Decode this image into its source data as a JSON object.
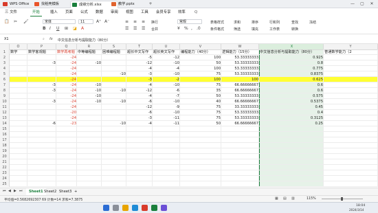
{
  "titlebar": {
    "tabs": [
      "WPS Office",
      "找稻壳模板",
      "成绩分析.xlsx",
      "教学.pptx"
    ],
    "minimize": "—",
    "maximize": "▢",
    "close": "✕"
  },
  "menu": {
    "items": [
      "三 文件",
      "开始",
      "插入",
      "页面",
      "公式",
      "数据",
      "审阅",
      "视图",
      "工具",
      "会员专享",
      "效率"
    ],
    "search": "Q"
  },
  "toolbar": {
    "font_name": "宋体",
    "font_size": "11",
    "wrap_label": "换行",
    "merge_label": "合并",
    "number_format": "常规",
    "table_style_label": "表格样式",
    "cond_format_label": "条件格式",
    "sum_label": "求和",
    "filter_label": "筛选",
    "sort_label": "排序",
    "fill_label": "填充",
    "rowcol_label": "行和列",
    "worksheet_label": "工作表",
    "find_label": "查找",
    "convert_label": "转换",
    "freeze_label": "冻结"
  },
  "formula": {
    "cell_ref": "X1",
    "fx": "fx",
    "content": "中文信息分析与提取能力（80分）"
  },
  "columns": [
    "O",
    "P",
    "Q",
    "R",
    "S",
    "T",
    "U",
    "V",
    "W",
    "X",
    "Y"
  ],
  "rows": [
    {
      "n": "1",
      "cells": [
        "数学",
        "数学客观题",
        "数学再考题",
        "中等编程题",
        "困难编程题",
        "超长中文写作",
        "超长英文写作",
        "编程能力（40分）",
        "逻辑能力（15分）",
        "中文信息分析与提取能力（80分）",
        "普通数学能力（2"
      ]
    },
    {
      "n": "2",
      "cells": [
        "",
        "",
        "-24",
        "",
        "",
        "-5",
        "-12",
        "100",
        "53.33333333",
        "0.925",
        ""
      ]
    },
    {
      "n": "3",
      "cells": [
        "",
        "-3",
        "-24",
        "-10",
        "",
        "-12",
        "-10",
        "50",
        "53.33333333",
        "0.8",
        ""
      ]
    },
    {
      "n": "4",
      "cells": [
        "",
        "",
        "-24",
        "",
        "",
        "-4",
        "-4",
        "100",
        "53.33333333",
        "0.775",
        ""
      ]
    },
    {
      "n": "5",
      "cells": [
        "",
        "",
        "-24",
        "",
        "-10",
        "-3",
        "-10",
        "75",
        "53.33333333",
        "0.8375",
        ""
      ]
    },
    {
      "n": "6",
      "cells": [
        "",
        "",
        "-24",
        "",
        "",
        "-3",
        "-2",
        "100",
        "100",
        "0.625",
        ""
      ]
    },
    {
      "n": "7",
      "cells": [
        "",
        "-3",
        "-24",
        "-10",
        "",
        "-4",
        "-10",
        "75",
        "66.66666667",
        "0.6",
        ""
      ]
    },
    {
      "n": "8",
      "cells": [
        "",
        "-3",
        "-24",
        "-10",
        "-10",
        "-12",
        "-6",
        "35",
        "66.66666667",
        "0.6",
        ""
      ]
    },
    {
      "n": "9",
      "cells": [
        "",
        "",
        "-24",
        "-10",
        "",
        "-4",
        "-7",
        "50",
        "53.33333333",
        "0.575",
        ""
      ]
    },
    {
      "n": "10",
      "cells": [
        "",
        "-3",
        "-24",
        "-10",
        "-10",
        "-6",
        "-10",
        "40",
        "66.66666667",
        "0.5375",
        ""
      ]
    },
    {
      "n": "11",
      "cells": [
        "",
        "",
        "-24",
        "",
        "",
        "-12",
        "-9",
        "75",
        "33.33333333",
        "0.45",
        ""
      ]
    },
    {
      "n": "12",
      "cells": [
        "",
        "",
        "-20",
        "",
        "",
        "-6",
        "-10",
        "75",
        "53.33333333",
        "0.4",
        ""
      ]
    },
    {
      "n": "13",
      "cells": [
        "",
        "",
        "-24",
        "",
        "",
        "-3",
        "-11",
        "75",
        "53.33333333",
        "0.3125",
        ""
      ]
    },
    {
      "n": "14",
      "cells": [
        "",
        "-6",
        "-23",
        "",
        "-10",
        "-4",
        "-11",
        "50",
        "66.66666667",
        "0.25",
        ""
      ]
    },
    {
      "n": "15",
      "cells": [
        "",
        "",
        "",
        "",
        "",
        "",
        "",
        "",
        "",
        "",
        ""
      ]
    },
    {
      "n": "16",
      "cells": [
        "",
        "",
        "",
        "",
        "",
        "",
        "",
        "",
        "",
        "",
        ""
      ]
    },
    {
      "n": "17",
      "cells": [
        "",
        "",
        "",
        "",
        "",
        "",
        "",
        "",
        "",
        "",
        ""
      ]
    },
    {
      "n": "18",
      "cells": [
        "",
        "",
        "",
        "",
        "",
        "",
        "",
        "",
        "",
        "",
        ""
      ]
    },
    {
      "n": "19",
      "cells": [
        "",
        "",
        "",
        "",
        "",
        "",
        "",
        "",
        "",
        "",
        ""
      ]
    },
    {
      "n": "20",
      "cells": [
        "",
        "",
        "",
        "",
        "",
        "",
        "",
        "",
        "",
        "",
        ""
      ]
    },
    {
      "n": "21",
      "cells": [
        "",
        "",
        "",
        "",
        "",
        "",
        "",
        "",
        "",
        "",
        ""
      ]
    },
    {
      "n": "22",
      "cells": [
        "",
        "",
        "",
        "",
        "",
        "",
        "",
        "",
        "",
        "",
        ""
      ]
    },
    {
      "n": "23",
      "cells": [
        "",
        "",
        "",
        "",
        "",
        "",
        "",
        "",
        "",
        "",
        ""
      ]
    },
    {
      "n": "24",
      "cells": [
        "",
        "",
        "",
        "",
        "",
        "",
        "",
        "",
        "",
        "",
        ""
      ]
    },
    {
      "n": "25",
      "cells": [
        "",
        "",
        "",
        "",
        "",
        "",
        "",
        "",
        "",
        "",
        ""
      ]
    }
  ],
  "sheets": [
    "Sheet1",
    "Sheet2",
    "Sheet3",
    "+"
  ],
  "status": {
    "summary": "平均值=0.5682692307 69 计数=14 求和=7.3875",
    "zoom": "115%"
  },
  "taskbar": {
    "time": "18:04",
    "date": "2024/3/14"
  },
  "colors": {
    "accent": "#1a7f3c",
    "highlight_row": "#ffff33",
    "red_text": "#d83b2b",
    "selected_col": "#e6f2e8"
  }
}
